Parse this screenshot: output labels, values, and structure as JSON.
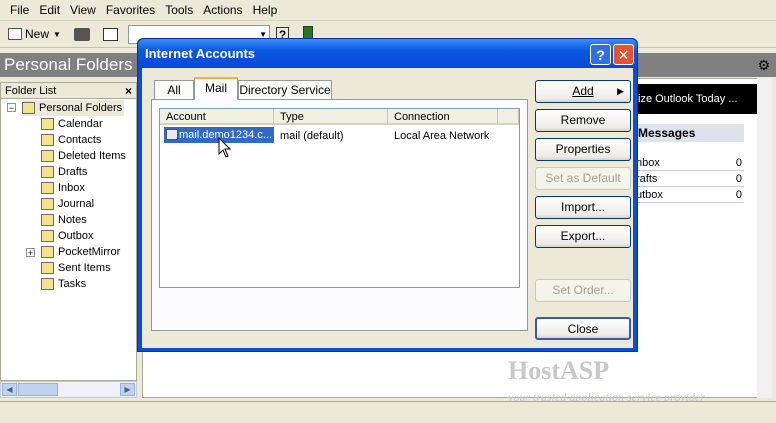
{
  "menubar": [
    "File",
    "Edit",
    "View",
    "Favorites",
    "Tools",
    "Actions",
    "Help"
  ],
  "toolbar": {
    "new_label": "New"
  },
  "left_pane": {
    "title": "Personal Folders",
    "folder_list_label": "Folder List",
    "close_glyph": "×",
    "tree": [
      {
        "label": "Personal Folders",
        "icon": "personal-folders-icon"
      },
      {
        "label": "Calendar",
        "icon": "calendar-icon"
      },
      {
        "label": "Contacts",
        "icon": "contacts-icon"
      },
      {
        "label": "Deleted Items",
        "icon": "deleted-items-icon"
      },
      {
        "label": "Drafts",
        "icon": "drafts-icon"
      },
      {
        "label": "Inbox",
        "icon": "inbox-icon"
      },
      {
        "label": "Journal",
        "icon": "journal-icon"
      },
      {
        "label": "Notes",
        "icon": "notes-icon"
      },
      {
        "label": "Outbox",
        "icon": "outbox-icon"
      },
      {
        "label": "PocketMirror",
        "icon": "pocketmirror-icon"
      },
      {
        "label": "Sent Items",
        "icon": "sent-items-icon"
      },
      {
        "label": "Tasks",
        "icon": "tasks-icon"
      }
    ]
  },
  "right_pane": {
    "banner": "ize Outlook Today ...",
    "messages_header": "Messages",
    "rows": [
      {
        "label": "nbox",
        "count": "0"
      },
      {
        "label": "rafts",
        "count": "0"
      },
      {
        "label": "utbox",
        "count": "0"
      }
    ]
  },
  "dialog": {
    "title": "Internet Accounts",
    "help_glyph": "?",
    "close_glyph": "✕",
    "tabs": [
      "All",
      "Mail",
      "Directory Service"
    ],
    "columns": [
      "Account",
      "Type",
      "Connection"
    ],
    "row": {
      "account": "mail.demo1234.c...",
      "type": "mail (default)",
      "connection": "Local Area Network"
    },
    "buttons": {
      "add": "Add",
      "remove": "Remove",
      "properties": "Properties",
      "set_default": "Set as Default",
      "import": "Import...",
      "export": "Export...",
      "set_order": "Set Order...",
      "close": "Close"
    }
  },
  "watermark": {
    "brand": "HostASP",
    "tagline": "your trusted application service provider"
  },
  "colors": {
    "titlebar": "#0a58e1",
    "selection": "#316ac5",
    "pane_header": "#808080"
  }
}
